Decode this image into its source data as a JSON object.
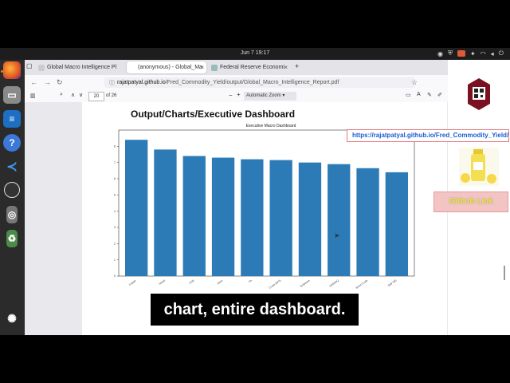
{
  "system": {
    "clock": "Jun 7  19:17"
  },
  "browser": {
    "tabs": [
      {
        "label": "Global Macro Intelligence Pl",
        "active": false
      },
      {
        "label": "(anonymous) - Global_Ma",
        "active": true
      },
      {
        "label": "Federal Reserve Economi",
        "active": false
      }
    ],
    "new_tab": "+",
    "url_host": "rajatpatyal.github.io",
    "url_path": "/Fred_Commodity_Yield/output/Global_Macro_Intelligence_Report.pdf",
    "page_number": "20",
    "page_total": "of 26",
    "zoom": "Automatic Zoom"
  },
  "pdf": {
    "heading": "Output/Charts/Executive Dashboard"
  },
  "overlay": {
    "repo_url": "https://rajatpatyal.github.io/Fred_Commodity_Yield/",
    "github_link": "Github Link",
    "caption": "chart, entire dashboard."
  },
  "chart_data": {
    "type": "bar",
    "title": "Executive Macro Dashboard",
    "categories": [
      "Copper",
      "Nickel",
      "Gold",
      "Silver",
      "Tin",
      "Crude (WTI)",
      "Soybeans",
      "NASDAQ",
      "Brent Crude",
      "S&P 500"
    ],
    "values": [
      8.4,
      7.8,
      7.4,
      7.3,
      7.2,
      7.15,
      7.0,
      6.9,
      6.65,
      6.4
    ],
    "yticks": [
      0,
      1,
      2,
      3,
      4,
      5,
      6,
      7,
      8
    ],
    "ylim": [
      0,
      9
    ],
    "color": "#2c7bb6"
  }
}
